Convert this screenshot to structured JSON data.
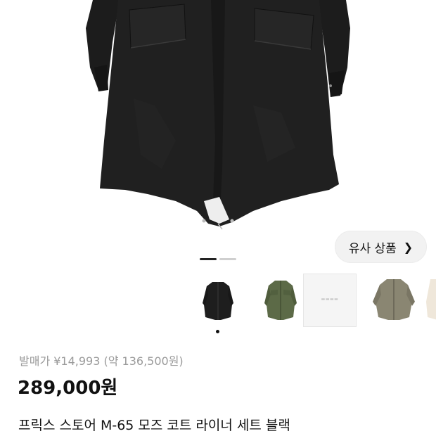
{
  "hero": {
    "image_name": "black-m65-mods-coat-photo"
  },
  "similar_button": {
    "label": "유사 상품",
    "icon": "chevron-right-icon"
  },
  "carousel": {
    "total": 2,
    "active_index": 0
  },
  "thumbnails": [
    {
      "name": "black-coat-thumb",
      "color": "#1e1e1e",
      "selected": true
    },
    {
      "name": "olive-coat-thumb",
      "color": "#5c6a47",
      "selected": false
    },
    {
      "name": "box-thumb",
      "color": "#f5f5f5",
      "selected": false
    },
    {
      "name": "khaki-coat-thumb",
      "color": "#8a8672",
      "selected": false
    },
    {
      "name": "cream-coat-thumb",
      "color": "#efe7da",
      "selected": false
    }
  ],
  "product": {
    "original_price": "발매가 ¥14,993 (약 136,500원)",
    "price": "289,000원",
    "title": "프릭스 스토어 M-65 모즈 코트 라이너 세트 블랙"
  }
}
